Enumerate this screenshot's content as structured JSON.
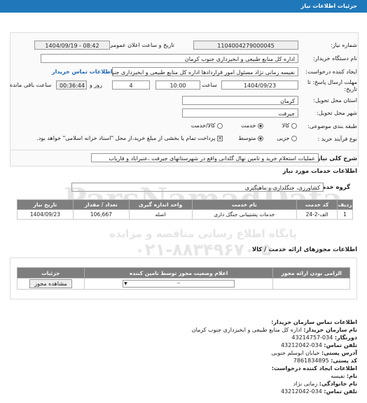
{
  "header": {
    "title": "جزئیات اطلاعات نیاز"
  },
  "fields": {
    "need_number_label": "شماره نیاز:",
    "need_number": "1104004279000045",
    "announce_label": "تاریخ و ساعت اعلان عمومی:",
    "announce_value": "1404/09/19 - 08:42",
    "buyer_label": "نام دستگاه خریدار:",
    "buyer_value": "اداره کل منابع طبیعی و ابخیزداری جنوب کرمان",
    "creator_label": "ایجاد کننده درخواست:",
    "creator_value": "نفیسه زمانی نژاد مسئول امور قراردادها اداره کل منابع طبیعی و ابخیزداری جنوب",
    "contact_link": "اطلاعات تماس خریدار",
    "deadline_label_1": "مهلت ارسال پاسخ: تا",
    "deadline_label_2": "تاریخ:",
    "deadline_date": "1404/09/23",
    "time_label": "ساعت",
    "time_value": "10:00",
    "days_value": "4",
    "days_label": "روز و",
    "remaining_value": "00:36:44",
    "remaining_label": "ساعت باقی مانده",
    "province_label": "استان محل تحویل:",
    "province_value": "کرمان",
    "city_label": "شهر محل تحویل:",
    "city_value": "جیرفت",
    "category_label": "طبقه بندی موضوعی:",
    "category_options": [
      "کالا",
      "خدمت",
      "کالا/خدمت"
    ],
    "process_label": "نوع فرآیند خرید :",
    "process_options": [
      "جزیی",
      "متوسط"
    ],
    "payment_note": "پرداخت تمام یا بخشی از مبلغ خرید،از محل \"اسناد خزانه اسلامی\" خواهد بود."
  },
  "description": {
    "label": "شرح کلی نیاز:",
    "value": "عملیات استعلام خرید و تامین نهال گلدانی واقع در شهرستانهای جیرفت ،عنبراباد و فاریاب"
  },
  "services": {
    "section_title": "اطلاعات خدمات مورد نیاز",
    "group_label": "گروه خدمت:",
    "group_value": "کشاورزی، جنگلداری و ماهیگیری",
    "headers": [
      "ردیف",
      "کد خدمت",
      "نام خدمت",
      "واحد اندازه گیری",
      "تعداد / مقدار",
      "تاریخ نیاز"
    ],
    "rows": [
      [
        "1",
        "الف-2-24",
        "خدمات پشتیبانی جنگل داری",
        "اصله",
        "106,667",
        "1404/09/23"
      ]
    ]
  },
  "licenses": {
    "section_title": "اطلاعات مجوزهای ارائه خدمت / کالا",
    "headers": [
      "الزامی بودن ارائه مجوز",
      "اعلام وضعیت مجوز توسط تامین کننده",
      "جزئیات"
    ],
    "row": {
      "required": "",
      "status": "--",
      "details_button": "مشاهده مجوز"
    }
  },
  "watermark": {
    "line1": "ParsNamadData",
    "line2": "پایگاه اطلاع رسانی مناقصه و مزایده",
    "line3": "۰۲۱-۸۸۳۴۹۶۷۰-۵"
  },
  "contact": {
    "section_title": "اطلاعات تماس سازمان خریدار:",
    "org_label": "نام سازمان خریدار:",
    "org_value": "اداره کل منابع طبیعی و ابخیزداری جنوب کرمان",
    "fax_label": "دورنگار:",
    "fax_value": "034-43214757",
    "phone_label": "تلفن تماس:",
    "phone_value": "034-43212042",
    "address_label": "آدرس پستی:",
    "address_value": "خیابان ابوسلم جنوبی",
    "postal_label": "کد پستی:",
    "postal_value": "7861834895",
    "creator_title": "اطلاعات ایجاد کننده درخواست:",
    "first_name_label": "نام:",
    "first_name_value": "نفیسه",
    "last_name_label": "نام خانوادگی:",
    "last_name_value": "زمانی نژاد",
    "creator_phone_label": "تلفن تماس:",
    "creator_phone_value": "034-43212042"
  }
}
